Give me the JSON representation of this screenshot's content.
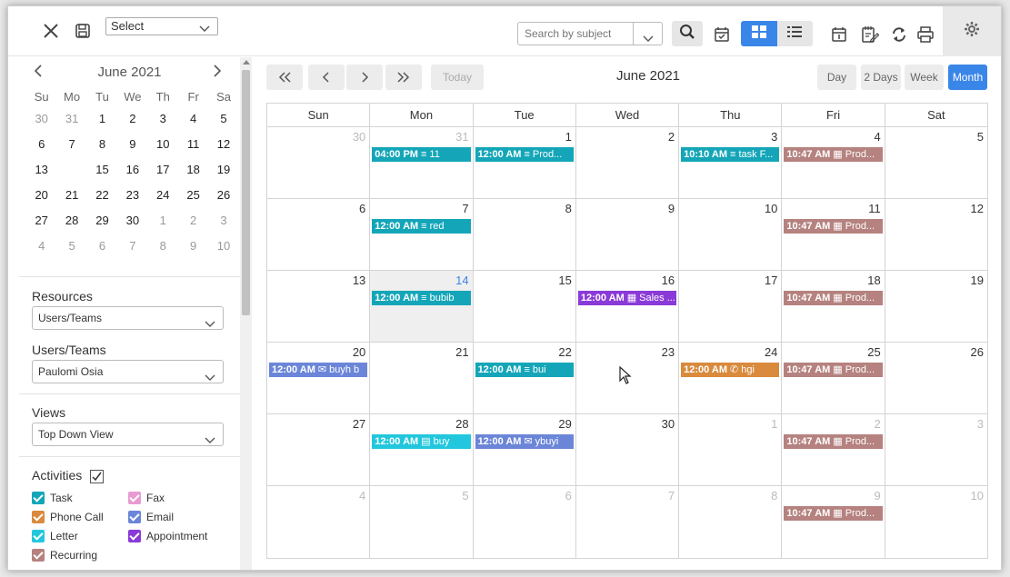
{
  "toolbar": {
    "select_label": "Select",
    "search_placeholder": "Search by subject"
  },
  "mini_calendar": {
    "title": "June 2021",
    "weekdays": [
      "Su",
      "Mo",
      "Tu",
      "We",
      "Th",
      "Fr",
      "Sa"
    ],
    "weeks": [
      [
        "30",
        "31",
        "1",
        "2",
        "3",
        "4",
        "5"
      ],
      [
        "6",
        "7",
        "8",
        "9",
        "10",
        "11",
        "12"
      ],
      [
        "13",
        "14",
        "15",
        "16",
        "17",
        "18",
        "19"
      ],
      [
        "20",
        "21",
        "22",
        "23",
        "24",
        "25",
        "26"
      ],
      [
        "27",
        "28",
        "29",
        "30",
        "1",
        "2",
        "3"
      ],
      [
        "4",
        "5",
        "6",
        "7",
        "8",
        "9",
        "10"
      ]
    ]
  },
  "filters": {
    "resources_label": "Resources",
    "resources_value": "Users/Teams",
    "users_label": "Users/Teams",
    "users_value": "Paulomi Osia",
    "views_label": "Views",
    "views_value": "Top Down View",
    "activities_label": "Activities",
    "activities": [
      {
        "label": "Task",
        "color": "#14a6b8"
      },
      {
        "label": "Fax",
        "color": "#e79bd0"
      },
      {
        "label": "Phone Call",
        "color": "#d98a3d"
      },
      {
        "label": "Email",
        "color": "#6b86d8"
      },
      {
        "label": "Letter",
        "color": "#22c7dd"
      },
      {
        "label": "Appointment",
        "color": "#8a3ad8"
      },
      {
        "label": "Recurring",
        "color": "#b5827f"
      }
    ]
  },
  "calendar": {
    "title": "June 2021",
    "today_label": "Today",
    "views": [
      "Day",
      "2 Days",
      "Week",
      "Month"
    ],
    "active_view": "Month",
    "weekdays": [
      "Sun",
      "Mon",
      "Tue",
      "Wed",
      "Thu",
      "Fri",
      "Sat"
    ],
    "weeks": [
      [
        {
          "d": "30",
          "dim": true
        },
        {
          "d": "31",
          "dim": true,
          "ev": {
            "time": "04:00 PM",
            "icon": "≡",
            "title": "11",
            "color": "#14a6b8"
          }
        },
        {
          "d": "1",
          "ev": {
            "time": "12:00 AM",
            "icon": "≡",
            "title": "Prod...",
            "color": "#14a6b8"
          }
        },
        {
          "d": "2"
        },
        {
          "d": "3",
          "ev": {
            "time": "10:10 AM",
            "icon": "≡",
            "title": "task F...",
            "color": "#14a6b8"
          }
        },
        {
          "d": "4",
          "ev": {
            "time": "10:47 AM",
            "icon": "▦",
            "title": "Prod...",
            "color": "#b5827f"
          }
        },
        {
          "d": "5"
        }
      ],
      [
        {
          "d": "6"
        },
        {
          "d": "7",
          "ev": {
            "time": "12:00 AM",
            "icon": "≡",
            "title": "red",
            "color": "#14a6b8"
          }
        },
        {
          "d": "8"
        },
        {
          "d": "9"
        },
        {
          "d": "10"
        },
        {
          "d": "11",
          "ev": {
            "time": "10:47 AM",
            "icon": "▦",
            "title": "Prod...",
            "color": "#b5827f"
          }
        },
        {
          "d": "12"
        }
      ],
      [
        {
          "d": "13"
        },
        {
          "d": "14",
          "today": true,
          "ev": {
            "time": "12:00 AM",
            "icon": "≡",
            "title": "bubib",
            "color": "#14a6b8"
          }
        },
        {
          "d": "15"
        },
        {
          "d": "16",
          "ev": {
            "time": "12:00 AM",
            "icon": "▦",
            "title": "Sales ...",
            "color": "#8a3ad8"
          }
        },
        {
          "d": "17"
        },
        {
          "d": "18",
          "ev": {
            "time": "10:47 AM",
            "icon": "▦",
            "title": "Prod...",
            "color": "#b5827f"
          }
        },
        {
          "d": "19"
        }
      ],
      [
        {
          "d": "20",
          "ev": {
            "time": "12:00 AM",
            "icon": "✉",
            "title": "buyh b",
            "color": "#6b86d8"
          }
        },
        {
          "d": "21"
        },
        {
          "d": "22",
          "ev": {
            "time": "12:00 AM",
            "icon": "≡",
            "title": "bui",
            "color": "#14a6b8"
          }
        },
        {
          "d": "23"
        },
        {
          "d": "24",
          "ev": {
            "time": "12:00 AM",
            "icon": "✆",
            "title": "hgi",
            "color": "#d98a3d"
          }
        },
        {
          "d": "25",
          "ev": {
            "time": "10:47 AM",
            "icon": "▦",
            "title": "Prod...",
            "color": "#b5827f"
          }
        },
        {
          "d": "26"
        }
      ],
      [
        {
          "d": "27"
        },
        {
          "d": "28",
          "ev": {
            "time": "12:00 AM",
            "icon": "▤",
            "title": "buy",
            "color": "#22c7dd"
          }
        },
        {
          "d": "29",
          "ev": {
            "time": "12:00 AM",
            "icon": "✉",
            "title": "ybuyi",
            "color": "#6b86d8"
          }
        },
        {
          "d": "30"
        },
        {
          "d": "1",
          "dim": true
        },
        {
          "d": "2",
          "dim": true,
          "ev": {
            "time": "10:47 AM",
            "icon": "▦",
            "title": "Prod...",
            "color": "#b5827f"
          }
        },
        {
          "d": "3",
          "dim": true
        }
      ],
      [
        {
          "d": "4",
          "dim": true
        },
        {
          "d": "5",
          "dim": true
        },
        {
          "d": "6",
          "dim": true
        },
        {
          "d": "7",
          "dim": true
        },
        {
          "d": "8",
          "dim": true
        },
        {
          "d": "9",
          "dim": true,
          "ev": {
            "time": "10:47 AM",
            "icon": "▦",
            "title": "Prod...",
            "color": "#b5827f"
          }
        },
        {
          "d": "10",
          "dim": true
        }
      ]
    ]
  }
}
